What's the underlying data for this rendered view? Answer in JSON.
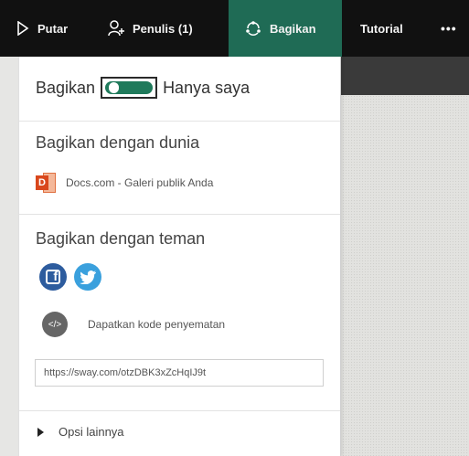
{
  "topbar": {
    "items": [
      {
        "label": "Putar",
        "icon": "play-icon",
        "active": false
      },
      {
        "label": "Penulis (1)",
        "icon": "person-add-icon",
        "active": false
      },
      {
        "label": "Bagikan",
        "icon": "share-icon",
        "active": true
      },
      {
        "label": "Tutorial",
        "icon": "",
        "active": false
      }
    ],
    "more_label": "•••"
  },
  "colors": {
    "topbar_bg": "#111111",
    "active_tab": "#1f6b55",
    "toggle_on": "#1f7a5b",
    "facebook": "#2d5c9e",
    "twitter": "#3aa0dd"
  },
  "share_panel": {
    "toggle": {
      "left_label": "Bagikan",
      "right_label": "Hanya saya",
      "state": "on"
    },
    "world": {
      "title": "Bagikan dengan dunia",
      "docs_icon": "docs-com-icon",
      "docs_label": "Docs.com - Galeri publik Anda"
    },
    "friends": {
      "title": "Bagikan dengan teman",
      "social": [
        "facebook-icon",
        "twitter-icon"
      ],
      "embed_label": "Dapatkan kode penyematan",
      "url": "https://sway.com/otzDBK3xZcHqIJ9t"
    },
    "more_options_label": "Opsi lainnya"
  }
}
